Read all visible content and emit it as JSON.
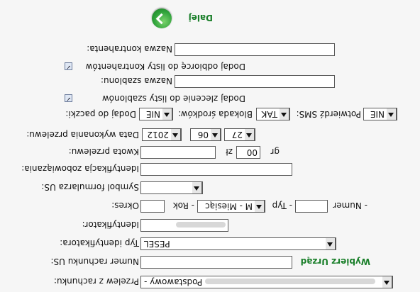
{
  "form": {
    "next": {
      "label": "Dalej"
    },
    "contractor": {
      "label": "Nazwa kontrahenta:",
      "value": ""
    },
    "add_recipient": {
      "label": "Dodaj odbiorcę do listy Kontrahentów",
      "checked": true
    },
    "template": {
      "label": "Nazwa szablonu:",
      "value": ""
    },
    "add_order": {
      "label": "Dodaj zlecenie do listy szablonów",
      "checked": true
    },
    "package": {
      "label": "Dodaj do paczki:",
      "value": "NIE"
    },
    "block_funds": {
      "label": "Blokada środków:",
      "value": "TAK"
    },
    "sms_confirm": {
      "label": "Potwierdź SMS:",
      "value": "NIE"
    },
    "execution_date": {
      "label": "Data wykonania przelewu:",
      "year": "2012",
      "month": "06",
      "day": "27"
    },
    "amount": {
      "label": "Kwota przelewu:",
      "zl_value": "",
      "zl_unit": "zł",
      "gr_value": "00",
      "gr_unit": "gr"
    },
    "obligation_id": {
      "label": "Identyfikacja zobowiązania:",
      "value": ""
    },
    "form_symbol": {
      "label": "Symbol formularza US:",
      "value": ""
    },
    "period": {
      "label": "Okres:",
      "value": "",
      "year_label": "- Rok",
      "type": "M - Miesiąc",
      "type_label": "- Typ",
      "number_value": "",
      "number_label": "- Numer"
    },
    "identifier": {
      "label": "Identyfikator:"
    },
    "identifier_type": {
      "label": "Typ identyfikatora:",
      "value": "PESEL"
    },
    "account": {
      "label": "Numer rachunku US:",
      "value": "",
      "link": "Wybierz Urząd"
    },
    "from_account": {
      "label": "Przelew z rachunku:",
      "value": "Podstawowy -"
    }
  }
}
